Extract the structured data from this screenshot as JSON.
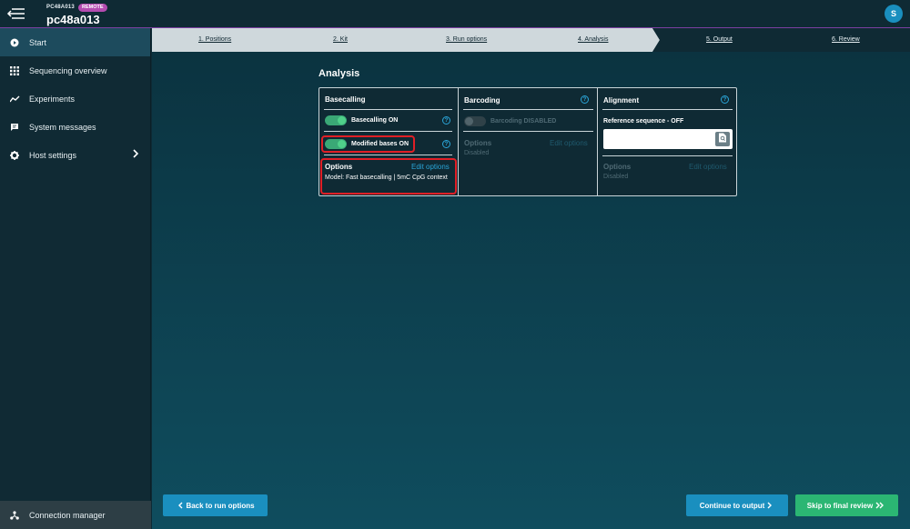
{
  "header": {
    "host_short": "PC48A013",
    "badge": "REMOTE",
    "host_name": "pc48a013",
    "avatar_initial": "S"
  },
  "sidebar": {
    "items": [
      {
        "label": "Start",
        "icon": "play-circle-icon",
        "active": true
      },
      {
        "label": "Sequencing overview",
        "icon": "grid-icon"
      },
      {
        "label": "Experiments",
        "icon": "line-chart-icon"
      },
      {
        "label": "System messages",
        "icon": "message-icon"
      },
      {
        "label": "Host settings",
        "icon": "gear-icon",
        "has_chevron": true
      }
    ],
    "footer_label": "Connection manager"
  },
  "stepper": {
    "steps": [
      {
        "label": "1. Positions"
      },
      {
        "label": "2. Kit"
      },
      {
        "label": "3. Run options"
      },
      {
        "label": "4. Analysis",
        "current": true
      },
      {
        "label": "5. Output"
      },
      {
        "label": "6. Review"
      }
    ]
  },
  "page": {
    "title": "Analysis"
  },
  "basecalling": {
    "title": "Basecalling",
    "toggle1_label": "Basecalling ON",
    "toggle2_label": "Modified bases ON",
    "options_title": "Options",
    "edit_label": "Edit options",
    "model_text": "Model: Fast basecalling | 5mC CpG context"
  },
  "barcoding": {
    "title": "Barcoding",
    "toggle_label": "Barcoding DISABLED",
    "options_title": "Options",
    "edit_label": "Edit options",
    "status": "Disabled"
  },
  "alignment": {
    "title": "Alignment",
    "ref_label": "Reference sequence - OFF",
    "options_title": "Options",
    "edit_label": "Edit options",
    "status": "Disabled"
  },
  "footer": {
    "back_label": "Back to run options",
    "continue_label": "Continue to output",
    "skip_label": "Skip to final review"
  },
  "colors": {
    "accent": "#1a8fbf",
    "success": "#2bb673",
    "highlight": "#e01f26",
    "remote_badge": "#b44bb0"
  }
}
